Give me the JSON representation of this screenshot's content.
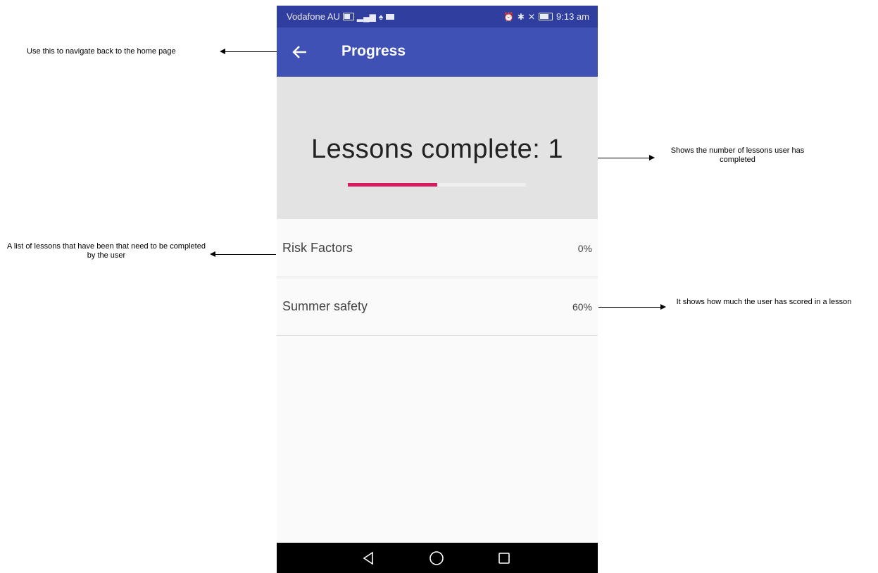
{
  "status_bar": {
    "carrier": "Vodafone AU",
    "time": "9:13 am"
  },
  "app_bar": {
    "title": "Progress"
  },
  "summary": {
    "lessons_complete_text": "Lessons complete: 1",
    "progress_fraction": 0.5
  },
  "lessons": [
    {
      "name": "Risk Factors",
      "score": "0%"
    },
    {
      "name": "Summer safety",
      "score": "60%"
    }
  ],
  "annotations": {
    "back": "Use this to navigate back to the home page",
    "lessons_complete": "Shows the number of lessons user has completed",
    "lesson_list": "A list of lessons that have been that need to be completed by the user",
    "score": "It shows how much the user has scored in a lesson"
  },
  "colors": {
    "status_bar": "#303f9f",
    "app_bar": "#3f51b5",
    "progress": "#d81b60",
    "progress_track": "#eeeeee",
    "header_panel": "#e3e3e3"
  },
  "icons": {
    "back": "arrow-back-icon",
    "nav_back": "triangle-back-icon",
    "nav_home": "circle-home-icon",
    "nav_recents": "square-recents-icon"
  }
}
